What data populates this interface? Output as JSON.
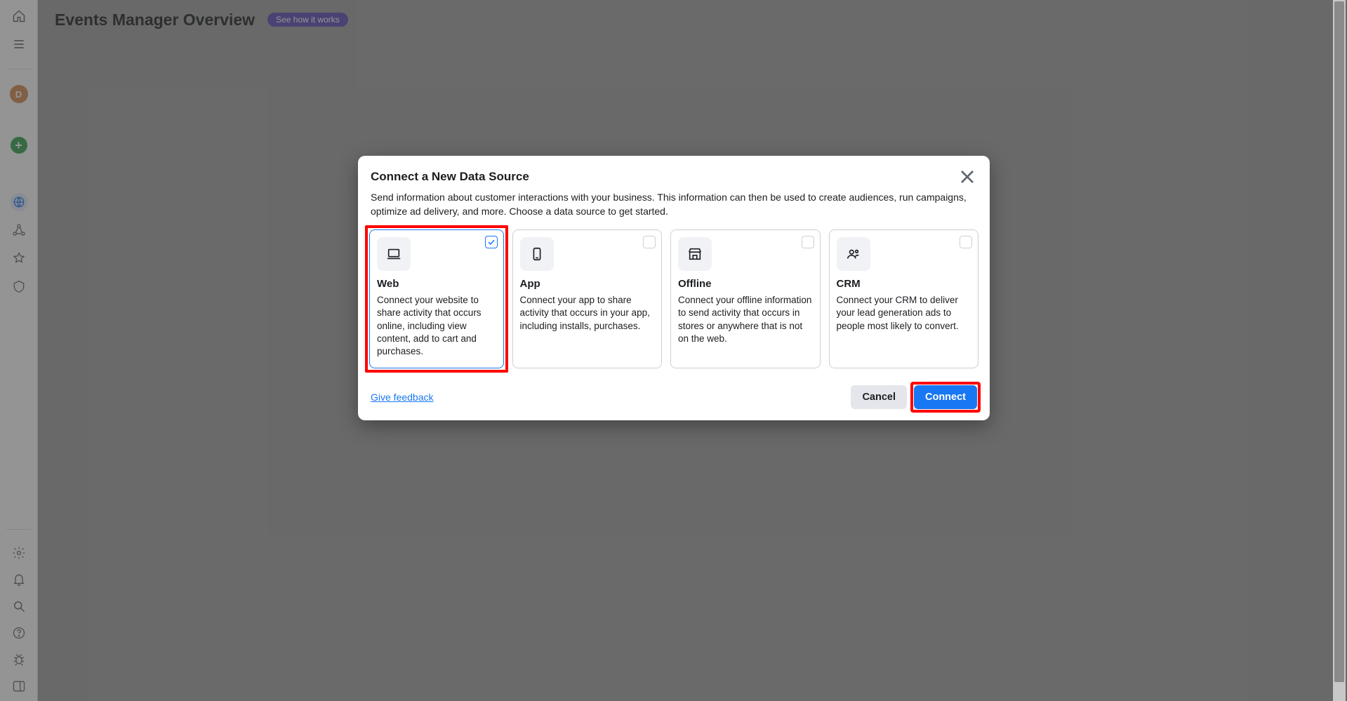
{
  "header": {
    "title": "Events Manager Overview",
    "pill": "See how it works"
  },
  "avatar_letter": "D",
  "modal": {
    "title": "Connect a New Data Source",
    "subtitle": "Send information about customer interactions with your business. This information can then be used to create audiences, run campaigns, optimize ad delivery, and more. Choose a data source to get started.",
    "cards": [
      {
        "title": "Web",
        "desc": "Connect your website to share activity that occurs online, including view content, add to cart and purchases."
      },
      {
        "title": "App",
        "desc": "Connect your app to share activity that occurs in your app, including installs, purchases."
      },
      {
        "title": "Offline",
        "desc": "Connect your offline information to send activity that occurs in stores or anywhere that is not on the web."
      },
      {
        "title": "CRM",
        "desc": "Connect your CRM to deliver your lead generation ads to people most likely to convert."
      }
    ],
    "feedback": "Give feedback",
    "cancel": "Cancel",
    "connect": "Connect"
  }
}
